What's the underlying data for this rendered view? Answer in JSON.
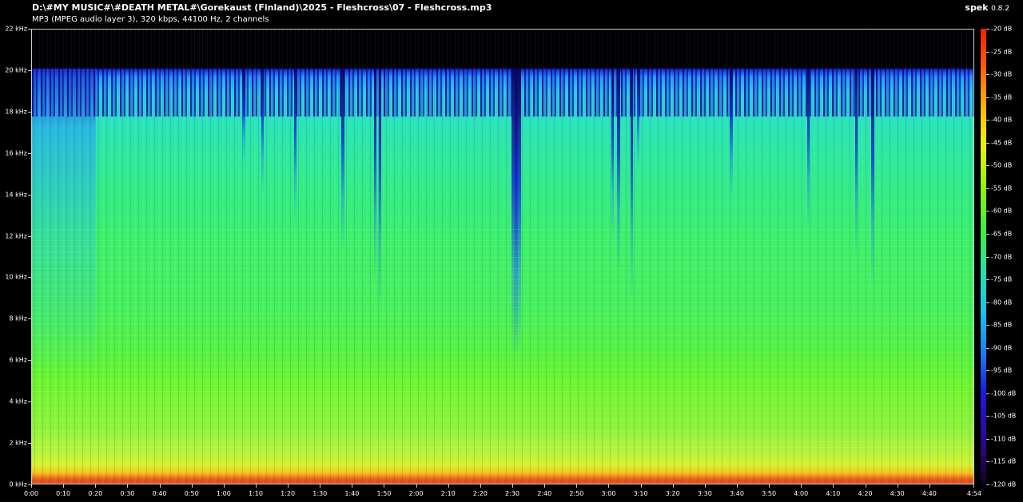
{
  "header": {
    "file_path": "D:\\#MY MUSIC#\\#DEATH METAL#\\Gorekaust (Finland)\\2025 - Fleshcross\\07 - Fleshcross.mp3",
    "file_info": "MP3 (MPEG audio layer 3), 320 kbps, 44100 Hz, 2 channels",
    "app_name": "spek",
    "app_version": "0.8.2"
  },
  "frequency_axis": {
    "labels": [
      "22 kHz",
      "20 kHz",
      "18 kHz",
      "16 kHz",
      "14 kHz",
      "12 kHz",
      "10 kHz",
      "8 kHz",
      "6 kHz",
      "4 kHz",
      "2 kHz",
      "0 kHz"
    ],
    "max_khz": 22
  },
  "time_axis": {
    "labels": [
      "0:00",
      "0:10",
      "0:20",
      "0:30",
      "0:40",
      "0:50",
      "1:00",
      "1:10",
      "1:20",
      "1:30",
      "1:40",
      "1:50",
      "2:00",
      "2:10",
      "2:20",
      "2:30",
      "2:40",
      "2:50",
      "3:00",
      "3:10",
      "3:20",
      "3:30",
      "3:40",
      "3:50",
      "4:00",
      "4:10",
      "4:20",
      "4:30",
      "4:40",
      "4:54"
    ],
    "seconds": [
      0,
      10,
      20,
      30,
      40,
      50,
      60,
      70,
      80,
      90,
      100,
      110,
      120,
      130,
      140,
      150,
      160,
      170,
      180,
      190,
      200,
      210,
      220,
      230,
      240,
      250,
      260,
      270,
      280,
      294
    ],
    "duration_seconds": 294
  },
  "color_scale": {
    "labels": [
      "-20 dB",
      "-25 dB",
      "-30 dB",
      "-35 dB",
      "-40 dB",
      "-45 dB",
      "-50 dB",
      "-55 dB",
      "-60 dB",
      "-65 dB",
      "-70 dB",
      "-75 dB",
      "-80 dB",
      "-85 dB",
      "-90 dB",
      "-95 dB",
      "-100 dB",
      "-105 dB",
      "-110 dB",
      "-115 dB",
      "-120 dB"
    ],
    "max_db": -20,
    "min_db": -120
  },
  "spectrogram": {
    "cutoff_khz": 20,
    "intro_end_seconds": 20,
    "dropouts_seconds": [
      66,
      72,
      82,
      97,
      107,
      108.5,
      150.5,
      151.5,
      181,
      183,
      187,
      189,
      218,
      242,
      257,
      262
    ]
  }
}
